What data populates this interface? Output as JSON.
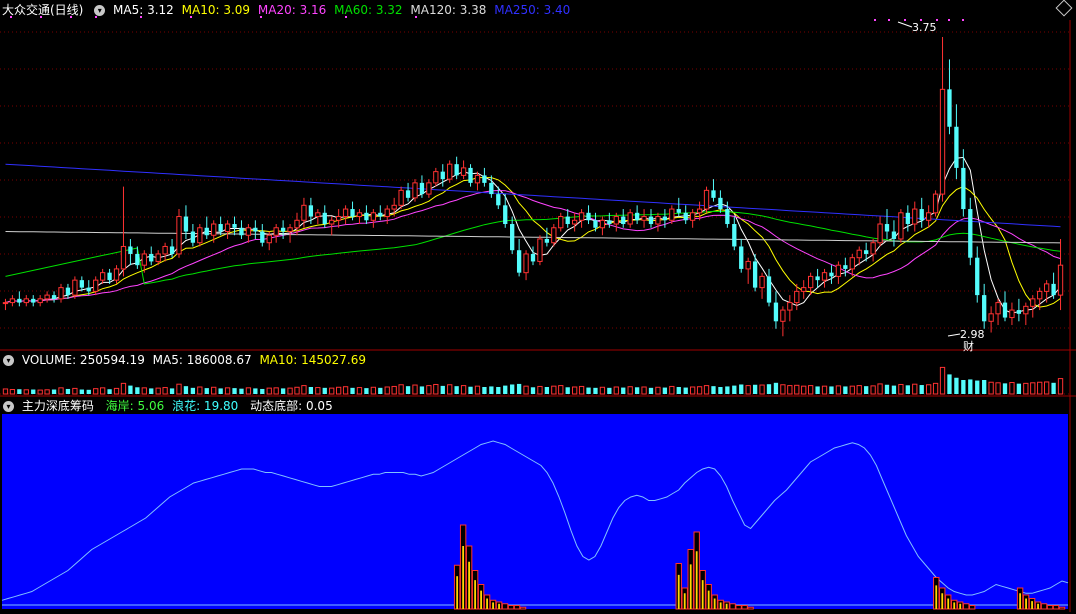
{
  "colors": {
    "up": "#ff3232",
    "down": "#54fcfc",
    "ma5": "#ffffff",
    "ma10": "#ffff00",
    "ma20": "#ff44ff",
    "ma60": "#00e000",
    "ma120": "#d0d0d0",
    "ma250": "#3030ff",
    "indicator_bg": "#0000ff",
    "indicator_line": "#80c0ff",
    "dotted_grid": "#7a0000",
    "panel_border": "#a00000"
  },
  "price_panel": {
    "title": "大众交通(日线)",
    "ma": [
      {
        "label": "MA5: 3.12",
        "color": "white"
      },
      {
        "label": "MA10: 3.09",
        "color": "yellow"
      },
      {
        "label": "MA20: 3.16",
        "color": "magenta"
      },
      {
        "label": "MA60: 3.32",
        "color": "green"
      },
      {
        "label": "MA120: 3.38",
        "color": "gray"
      },
      {
        "label": "MA250: 3.40",
        "color": "blue"
      }
    ],
    "high_label": "3.75",
    "low_label": "2.98",
    "event_badge": "财",
    "collapse_icon": "chevron-down-icon",
    "settings_icon": "diamond-icon"
  },
  "volume_panel": {
    "label": "VOLUME: 250594.19",
    "ma5": "MA5: 186008.67",
    "ma10": "MA10: 145027.69"
  },
  "indicator_panel": {
    "name": "主力深底筹码",
    "v1": "海岸: 5.06",
    "v2": "浪花: 19.80",
    "v3": "动态底部: 0.05"
  },
  "chart_data": {
    "type": "candlestick",
    "price_range": [
      2.95,
      3.8
    ],
    "candles": [
      [
        3.05,
        3.06,
        3.03,
        3.05
      ],
      [
        3.05,
        3.07,
        3.04,
        3.06
      ],
      [
        3.06,
        3.08,
        3.04,
        3.05
      ],
      [
        3.05,
        3.07,
        3.04,
        3.06
      ],
      [
        3.06,
        3.07,
        3.04,
        3.05
      ],
      [
        3.05,
        3.07,
        3.04,
        3.06
      ],
      [
        3.06,
        3.08,
        3.05,
        3.07
      ],
      [
        3.07,
        3.08,
        3.05,
        3.06
      ],
      [
        3.06,
        3.1,
        3.05,
        3.09
      ],
      [
        3.09,
        3.1,
        3.06,
        3.07
      ],
      [
        3.07,
        3.12,
        3.06,
        3.11
      ],
      [
        3.11,
        3.12,
        3.08,
        3.09
      ],
      [
        3.09,
        3.11,
        3.07,
        3.08
      ],
      [
        3.08,
        3.12,
        3.07,
        3.11
      ],
      [
        3.11,
        3.14,
        3.1,
        3.13
      ],
      [
        3.13,
        3.14,
        3.1,
        3.11
      ],
      [
        3.11,
        3.15,
        3.1,
        3.14
      ],
      [
        3.14,
        3.36,
        3.12,
        3.2
      ],
      [
        3.2,
        3.22,
        3.15,
        3.18
      ],
      [
        3.18,
        3.2,
        3.14,
        3.15
      ],
      [
        3.15,
        3.19,
        3.13,
        3.18
      ],
      [
        3.18,
        3.2,
        3.15,
        3.16
      ],
      [
        3.16,
        3.19,
        3.15,
        3.18
      ],
      [
        3.18,
        3.21,
        3.16,
        3.2
      ],
      [
        3.2,
        3.22,
        3.17,
        3.18
      ],
      [
        3.18,
        3.3,
        3.17,
        3.28
      ],
      [
        3.28,
        3.31,
        3.22,
        3.24
      ],
      [
        3.24,
        3.26,
        3.2,
        3.21
      ],
      [
        3.21,
        3.26,
        3.2,
        3.25
      ],
      [
        3.25,
        3.28,
        3.22,
        3.23
      ],
      [
        3.23,
        3.27,
        3.21,
        3.26
      ],
      [
        3.26,
        3.28,
        3.23,
        3.24
      ],
      [
        3.24,
        3.27,
        3.22,
        3.26
      ],
      [
        3.26,
        3.28,
        3.23,
        3.25
      ],
      [
        3.25,
        3.27,
        3.22,
        3.23
      ],
      [
        3.23,
        3.26,
        3.21,
        3.25
      ],
      [
        3.25,
        3.27,
        3.22,
        3.24
      ],
      [
        3.24,
        3.26,
        3.2,
        3.21
      ],
      [
        3.21,
        3.24,
        3.19,
        3.23
      ],
      [
        3.23,
        3.26,
        3.21,
        3.25
      ],
      [
        3.25,
        3.27,
        3.22,
        3.24
      ],
      [
        3.24,
        3.26,
        3.21,
        3.25
      ],
      [
        3.25,
        3.29,
        3.23,
        3.27
      ],
      [
        3.27,
        3.33,
        3.25,
        3.31
      ],
      [
        3.31,
        3.33,
        3.26,
        3.28
      ],
      [
        3.28,
        3.3,
        3.26,
        3.29
      ],
      [
        3.29,
        3.31,
        3.25,
        3.26
      ],
      [
        3.26,
        3.28,
        3.23,
        3.27
      ],
      [
        3.27,
        3.3,
        3.25,
        3.28
      ],
      [
        3.28,
        3.31,
        3.26,
        3.3
      ],
      [
        3.3,
        3.32,
        3.27,
        3.28
      ],
      [
        3.28,
        3.3,
        3.26,
        3.29
      ],
      [
        3.29,
        3.31,
        3.26,
        3.27
      ],
      [
        3.27,
        3.3,
        3.25,
        3.29
      ],
      [
        3.29,
        3.31,
        3.27,
        3.28
      ],
      [
        3.28,
        3.31,
        3.26,
        3.3
      ],
      [
        3.3,
        3.33,
        3.28,
        3.31
      ],
      [
        3.31,
        3.36,
        3.3,
        3.35
      ],
      [
        3.35,
        3.37,
        3.32,
        3.33
      ],
      [
        3.33,
        3.38,
        3.32,
        3.37
      ],
      [
        3.37,
        3.39,
        3.33,
        3.34
      ],
      [
        3.34,
        3.38,
        3.33,
        3.37
      ],
      [
        3.37,
        3.41,
        3.36,
        3.4
      ],
      [
        3.4,
        3.42,
        3.36,
        3.38
      ],
      [
        3.38,
        3.43,
        3.37,
        3.42
      ],
      [
        3.42,
        3.44,
        3.38,
        3.39
      ],
      [
        3.39,
        3.43,
        3.38,
        3.41
      ],
      [
        3.41,
        3.42,
        3.36,
        3.37
      ],
      [
        3.37,
        3.4,
        3.35,
        3.39
      ],
      [
        3.39,
        3.41,
        3.36,
        3.37
      ],
      [
        3.37,
        3.39,
        3.33,
        3.34
      ],
      [
        3.34,
        3.36,
        3.3,
        3.31
      ],
      [
        3.31,
        3.34,
        3.25,
        3.26
      ],
      [
        3.26,
        3.28,
        3.18,
        3.19
      ],
      [
        3.19,
        3.22,
        3.12,
        3.13
      ],
      [
        3.13,
        3.19,
        3.11,
        3.18
      ],
      [
        3.18,
        3.2,
        3.15,
        3.16
      ],
      [
        3.16,
        3.23,
        3.15,
        3.22
      ],
      [
        3.22,
        3.25,
        3.2,
        3.21
      ],
      [
        3.21,
        3.26,
        3.2,
        3.25
      ],
      [
        3.25,
        3.29,
        3.24,
        3.28
      ],
      [
        3.28,
        3.3,
        3.25,
        3.26
      ],
      [
        3.26,
        3.29,
        3.24,
        3.27
      ],
      [
        3.27,
        3.3,
        3.25,
        3.29
      ],
      [
        3.29,
        3.31,
        3.26,
        3.27
      ],
      [
        3.27,
        3.29,
        3.24,
        3.25
      ],
      [
        3.25,
        3.28,
        3.23,
        3.27
      ],
      [
        3.27,
        3.29,
        3.25,
        3.26
      ],
      [
        3.26,
        3.29,
        3.24,
        3.28
      ],
      [
        3.28,
        3.3,
        3.25,
        3.26
      ],
      [
        3.26,
        3.3,
        3.25,
        3.29
      ],
      [
        3.29,
        3.31,
        3.26,
        3.27
      ],
      [
        3.27,
        3.3,
        3.25,
        3.28
      ],
      [
        3.28,
        3.3,
        3.25,
        3.26
      ],
      [
        3.26,
        3.29,
        3.24,
        3.28
      ],
      [
        3.28,
        3.3,
        3.25,
        3.27
      ],
      [
        3.27,
        3.31,
        3.26,
        3.3
      ],
      [
        3.3,
        3.33,
        3.28,
        3.29
      ],
      [
        3.29,
        3.31,
        3.26,
        3.27
      ],
      [
        3.27,
        3.3,
        3.25,
        3.29
      ],
      [
        3.29,
        3.32,
        3.27,
        3.3
      ],
      [
        3.3,
        3.36,
        3.29,
        3.35
      ],
      [
        3.35,
        3.38,
        3.32,
        3.33
      ],
      [
        3.33,
        3.35,
        3.29,
        3.3
      ],
      [
        3.3,
        3.32,
        3.25,
        3.26
      ],
      [
        3.26,
        3.28,
        3.19,
        3.2
      ],
      [
        3.2,
        3.22,
        3.13,
        3.14
      ],
      [
        3.14,
        3.17,
        3.1,
        3.16
      ],
      [
        3.16,
        3.18,
        3.08,
        3.09
      ],
      [
        3.09,
        3.13,
        3.06,
        3.12
      ],
      [
        3.12,
        3.14,
        3.04,
        3.05
      ],
      [
        3.05,
        3.08,
        2.98,
        3.0
      ],
      [
        3.0,
        3.04,
        2.96,
        3.03
      ],
      [
        3.03,
        3.07,
        3.0,
        3.05
      ],
      [
        3.05,
        3.1,
        3.03,
        3.08
      ],
      [
        3.08,
        3.11,
        3.06,
        3.09
      ],
      [
        3.09,
        3.13,
        3.07,
        3.12
      ],
      [
        3.12,
        3.14,
        3.09,
        3.11
      ],
      [
        3.11,
        3.14,
        3.09,
        3.13
      ],
      [
        3.13,
        3.15,
        3.1,
        3.12
      ],
      [
        3.12,
        3.16,
        3.1,
        3.15
      ],
      [
        3.15,
        3.17,
        3.12,
        3.14
      ],
      [
        3.14,
        3.18,
        3.12,
        3.17
      ],
      [
        3.17,
        3.2,
        3.15,
        3.19
      ],
      [
        3.19,
        3.21,
        3.16,
        3.18
      ],
      [
        3.18,
        3.22,
        3.16,
        3.21
      ],
      [
        3.21,
        3.28,
        3.2,
        3.26
      ],
      [
        3.26,
        3.3,
        3.22,
        3.24
      ],
      [
        3.24,
        3.27,
        3.2,
        3.22
      ],
      [
        3.22,
        3.3,
        3.21,
        3.29
      ],
      [
        3.29,
        3.31,
        3.24,
        3.26
      ],
      [
        3.26,
        3.32,
        3.24,
        3.3
      ],
      [
        3.3,
        3.33,
        3.25,
        3.27
      ],
      [
        3.27,
        3.31,
        3.25,
        3.29
      ],
      [
        3.29,
        3.35,
        3.28,
        3.34
      ],
      [
        3.34,
        3.76,
        3.32,
        3.62
      ],
      [
        3.62,
        3.7,
        3.5,
        3.52
      ],
      [
        3.52,
        3.58,
        3.38,
        3.41
      ],
      [
        3.41,
        3.46,
        3.28,
        3.3
      ],
      [
        3.3,
        3.33,
        3.15,
        3.17
      ],
      [
        3.17,
        3.2,
        3.05,
        3.07
      ],
      [
        3.07,
        3.1,
        2.98,
        3.0
      ],
      [
        3.0,
        3.04,
        2.97,
        3.02
      ],
      [
        3.02,
        3.06,
        2.99,
        3.05
      ],
      [
        3.05,
        3.08,
        3.0,
        3.01
      ],
      [
        3.01,
        3.05,
        2.99,
        3.03
      ],
      [
        3.03,
        3.06,
        3.0,
        3.02
      ],
      [
        3.02,
        3.05,
        2.99,
        3.04
      ],
      [
        3.04,
        3.07,
        3.01,
        3.06
      ],
      [
        3.06,
        3.09,
        3.03,
        3.08
      ],
      [
        3.08,
        3.11,
        3.05,
        3.1
      ],
      [
        3.1,
        3.13,
        3.06,
        3.07
      ],
      [
        3.07,
        3.22,
        3.03,
        3.15
      ]
    ],
    "volume": [
      0.18,
      0.16,
      0.17,
      0.15,
      0.16,
      0.14,
      0.15,
      0.16,
      0.22,
      0.18,
      0.2,
      0.16,
      0.15,
      0.19,
      0.22,
      0.17,
      0.2,
      0.38,
      0.3,
      0.24,
      0.22,
      0.2,
      0.21,
      0.23,
      0.2,
      0.35,
      0.28,
      0.22,
      0.25,
      0.21,
      0.24,
      0.2,
      0.22,
      0.21,
      0.19,
      0.22,
      0.2,
      0.18,
      0.21,
      0.22,
      0.2,
      0.21,
      0.24,
      0.3,
      0.25,
      0.23,
      0.22,
      0.21,
      0.24,
      0.26,
      0.22,
      0.23,
      0.21,
      0.24,
      0.22,
      0.25,
      0.27,
      0.33,
      0.28,
      0.32,
      0.27,
      0.3,
      0.34,
      0.29,
      0.33,
      0.28,
      0.3,
      0.26,
      0.28,
      0.25,
      0.27,
      0.25,
      0.3,
      0.34,
      0.36,
      0.28,
      0.24,
      0.27,
      0.25,
      0.28,
      0.3,
      0.24,
      0.25,
      0.27,
      0.23,
      0.22,
      0.24,
      0.22,
      0.25,
      0.23,
      0.26,
      0.24,
      0.25,
      0.22,
      0.24,
      0.23,
      0.27,
      0.25,
      0.23,
      0.25,
      0.26,
      0.3,
      0.28,
      0.25,
      0.27,
      0.3,
      0.34,
      0.3,
      0.33,
      0.32,
      0.35,
      0.4,
      0.33,
      0.3,
      0.31,
      0.28,
      0.3,
      0.27,
      0.28,
      0.27,
      0.29,
      0.27,
      0.28,
      0.3,
      0.28,
      0.29,
      0.36,
      0.33,
      0.3,
      0.34,
      0.31,
      0.35,
      0.32,
      0.33,
      0.38,
      0.95,
      0.7,
      0.58,
      0.5,
      0.52,
      0.48,
      0.5,
      0.42,
      0.4,
      0.38,
      0.41,
      0.37,
      0.38,
      0.4,
      0.42,
      0.43,
      0.4,
      0.55
    ],
    "volume_range": [
      0,
      1
    ],
    "indicator": {
      "range": [
        0,
        100
      ],
      "line": [
        5,
        6,
        7,
        8,
        9,
        10,
        12,
        14,
        16,
        18,
        20,
        22,
        25,
        28,
        31,
        34,
        36,
        38,
        40,
        42,
        44,
        46,
        48,
        50,
        52,
        55,
        58,
        61,
        64,
        66,
        68,
        70,
        72,
        73,
        74,
        75,
        76,
        77,
        78,
        79,
        80,
        80,
        80,
        79,
        78,
        78,
        77,
        76,
        75,
        74,
        73,
        72,
        71,
        70,
        70,
        70,
        71,
        72,
        73,
        74,
        75,
        76,
        77,
        77,
        78,
        78,
        78,
        78,
        77,
        77,
        76,
        77,
        78,
        80,
        82,
        84,
        86,
        88,
        90,
        92,
        94,
        95,
        96,
        95,
        94,
        92,
        90,
        88,
        86,
        84,
        82,
        78,
        72,
        64,
        55,
        45,
        36,
        30,
        28,
        30,
        36,
        44,
        52,
        58,
        62,
        64,
        65,
        64,
        62,
        62,
        63,
        64,
        66,
        68,
        72,
        75,
        78,
        80,
        81,
        80,
        76,
        70,
        62,
        55,
        48,
        46,
        50,
        54,
        58,
        62,
        65,
        68,
        72,
        76,
        80,
        84,
        86,
        88,
        90,
        92,
        93,
        94,
        95,
        94,
        92,
        88,
        82,
        74,
        66,
        58,
        50,
        42,
        36,
        30,
        26,
        22,
        18,
        15,
        12,
        10,
        9,
        8,
        8,
        9,
        10,
        12,
        14,
        13,
        12,
        11,
        10,
        9,
        9,
        10,
        11,
        12,
        14,
        16,
        15
      ],
      "bars": [
        {
          "start": 76,
          "heights": [
            25,
            48,
            36,
            22,
            14,
            8,
            5,
            4,
            3,
            2,
            2,
            1
          ]
        },
        {
          "start": 113,
          "heights": [
            26,
            12,
            34,
            44,
            22,
            14,
            8,
            5,
            4,
            3,
            2,
            2,
            1
          ]
        },
        {
          "start": 156,
          "heights": [
            18,
            12,
            8,
            5,
            4,
            3,
            2
          ]
        },
        {
          "start": 170,
          "heights": [
            12,
            8,
            6,
            4,
            3,
            2,
            2,
            1
          ]
        }
      ]
    }
  }
}
